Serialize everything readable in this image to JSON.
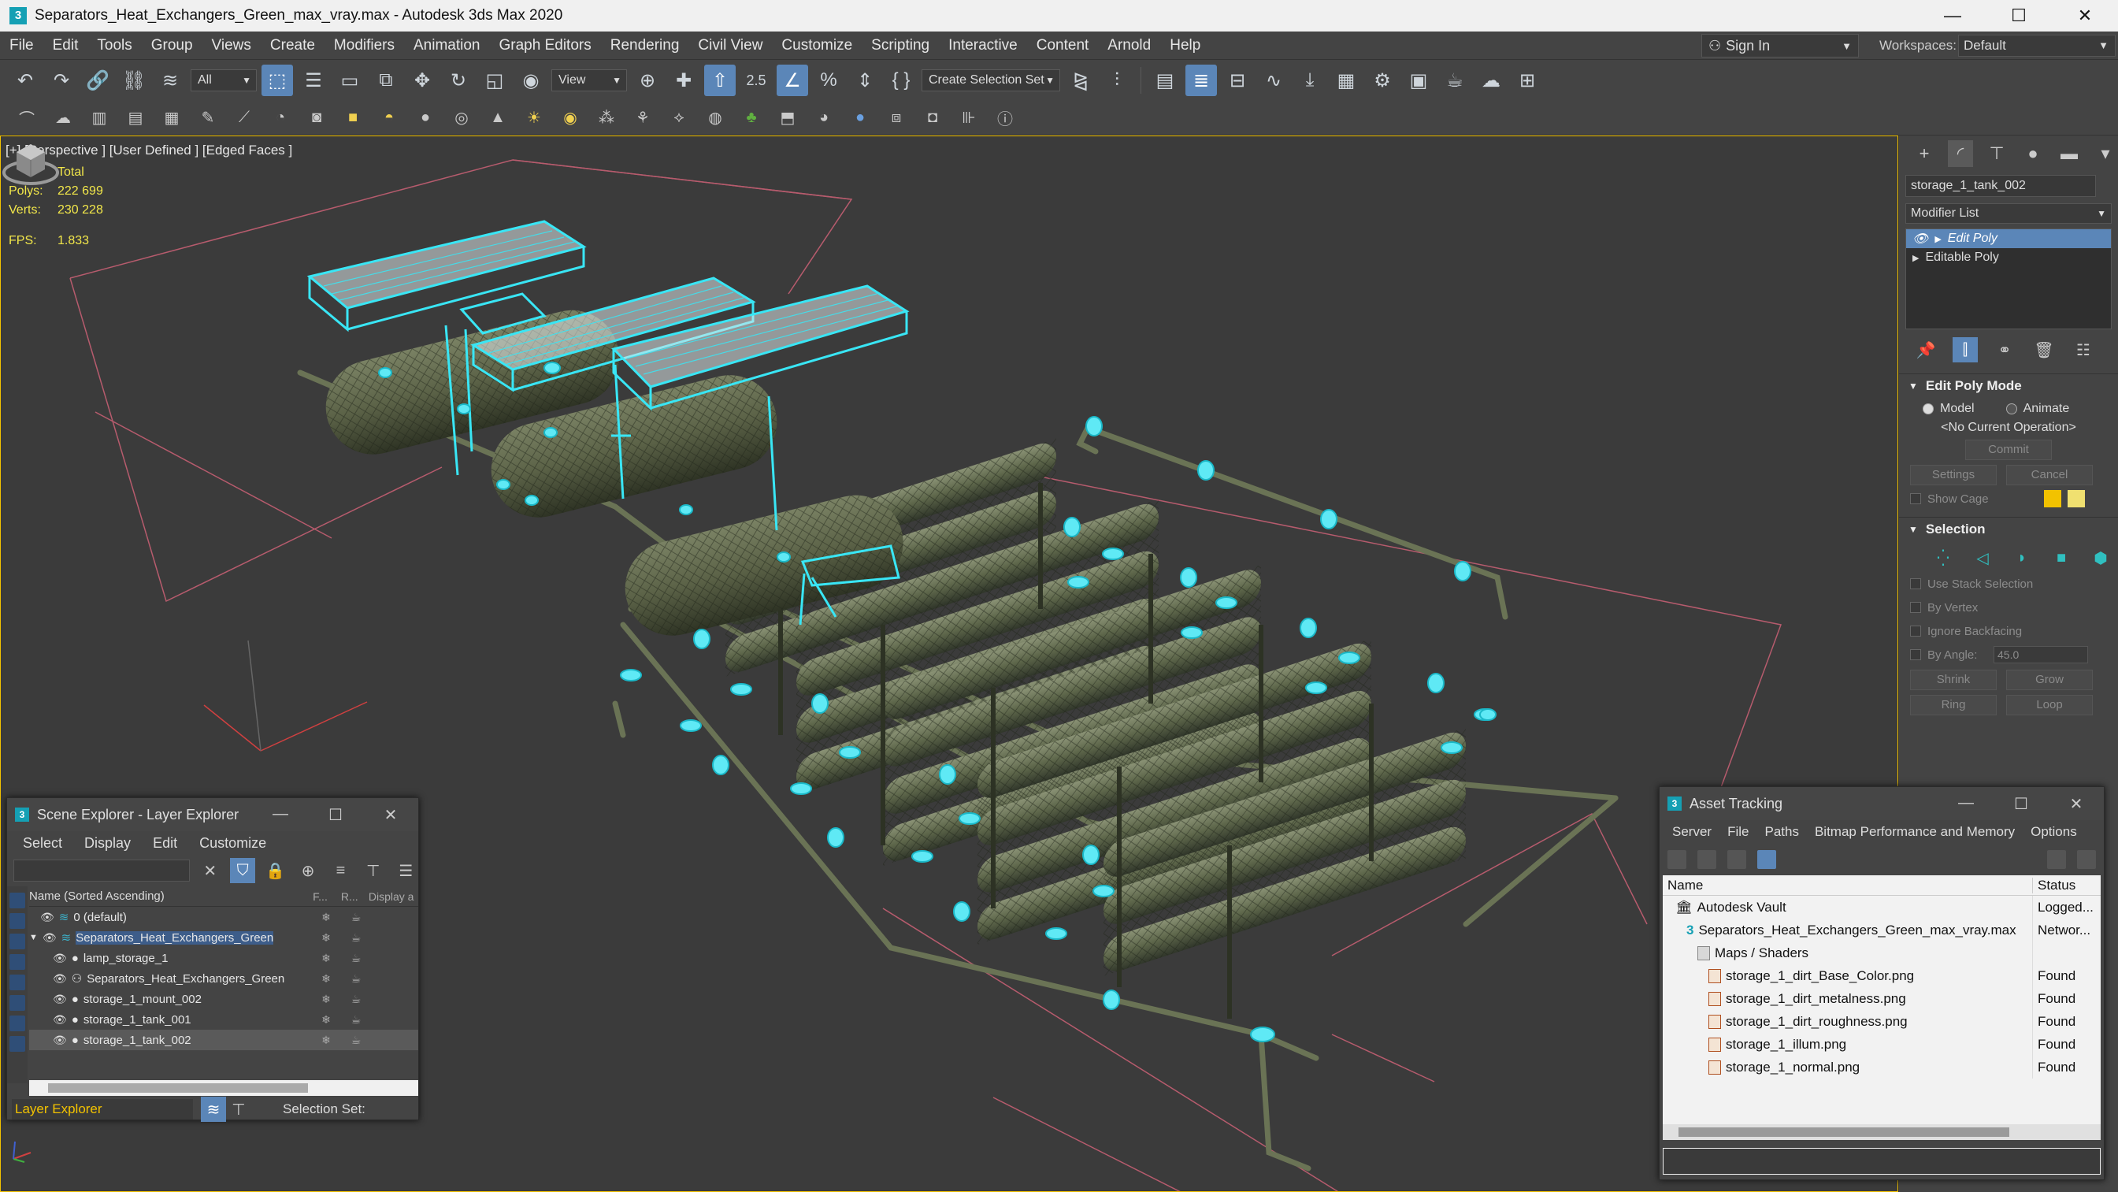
{
  "window": {
    "title": "Separators_Heat_Exchangers_Green_max_vray.max - Autodesk 3ds Max 2020",
    "minimize": "—",
    "maximize": "☐",
    "close": "✕"
  },
  "menu": [
    "File",
    "Edit",
    "Tools",
    "Group",
    "Views",
    "Create",
    "Modifiers",
    "Animation",
    "Graph Editors",
    "Rendering",
    "Civil View",
    "Customize",
    "Scripting",
    "Interactive",
    "Content",
    "Arnold",
    "Help"
  ],
  "signin": {
    "label": "Sign In"
  },
  "workspaces": {
    "label": "Workspaces:",
    "value": "Default"
  },
  "toolbar": {
    "filter_value": "All",
    "ref_coord_value": "View",
    "selection_set_placeholder": "Create Selection Set",
    "snap_label": "2.5"
  },
  "viewport": {
    "label": "[+] [Perspective ] [User Defined ] [Edged Faces ]",
    "stats_header": "Total",
    "polys_label": "Polys:",
    "polys_value": "222 699",
    "verts_label": "Verts:",
    "verts_value": "230 228",
    "fps_label": "FPS:",
    "fps_value": "1.833"
  },
  "command_panel": {
    "object_name": "storage_1_tank_002",
    "modifier_list": "Modifier List",
    "stack": [
      "Edit Poly",
      "Editable Poly"
    ],
    "edit_poly_mode": {
      "title": "Edit Poly Mode",
      "model": "Model",
      "animate": "Animate",
      "current_op": "<No Current Operation>",
      "commit": "Commit",
      "settings": "Settings",
      "cancel": "Cancel",
      "show_cage": "Show Cage"
    },
    "selection": {
      "title": "Selection",
      "use_stack": "Use Stack Selection",
      "by_vertex": "By Vertex",
      "ignore_backfacing": "Ignore Backfacing",
      "by_angle": "By Angle:",
      "angle_value": "45.0",
      "shrink": "Shrink",
      "grow": "Grow",
      "ring": "Ring",
      "loop": "Loop"
    },
    "colors": {
      "cage1": "#f2c200",
      "cage2": "#f0e070",
      "accent": "#5b86b8"
    }
  },
  "scene_explorer": {
    "title": "Scene Explorer - Layer Explorer",
    "menu": [
      "Select",
      "Display",
      "Edit",
      "Customize"
    ],
    "col_name": "Name (Sorted Ascending)",
    "col_f": "F...",
    "col_r": "R...",
    "col_display": "Display a",
    "rows": [
      {
        "name": "0 (default)"
      },
      {
        "name": "Separators_Heat_Exchangers_Green"
      },
      {
        "name": "lamp_storage_1"
      },
      {
        "name": "Separators_Heat_Exchangers_Green"
      },
      {
        "name": "storage_1_mount_002"
      },
      {
        "name": "storage_1_tank_001"
      },
      {
        "name": "storage_1_tank_002"
      }
    ],
    "footer_explorer": "Layer Explorer",
    "footer_selset": "Selection Set:"
  },
  "asset_tracking": {
    "title": "Asset Tracking",
    "menu": [
      "Server",
      "File",
      "Paths",
      "Bitmap Performance and Memory",
      "Options"
    ],
    "col_name": "Name",
    "col_status": "Status",
    "rows": [
      {
        "name": "Autodesk Vault",
        "status": "Logged..."
      },
      {
        "name": "Separators_Heat_Exchangers_Green_max_vray.max",
        "status": "Networ..."
      },
      {
        "name": "Maps / Shaders",
        "status": ""
      },
      {
        "name": "storage_1_dirt_Base_Color.png",
        "status": "Found"
      },
      {
        "name": "storage_1_dirt_metalness.png",
        "status": "Found"
      },
      {
        "name": "storage_1_dirt_roughness.png",
        "status": "Found"
      },
      {
        "name": "storage_1_illum.png",
        "status": "Found"
      },
      {
        "name": "storage_1_normal.png",
        "status": "Found"
      }
    ]
  }
}
